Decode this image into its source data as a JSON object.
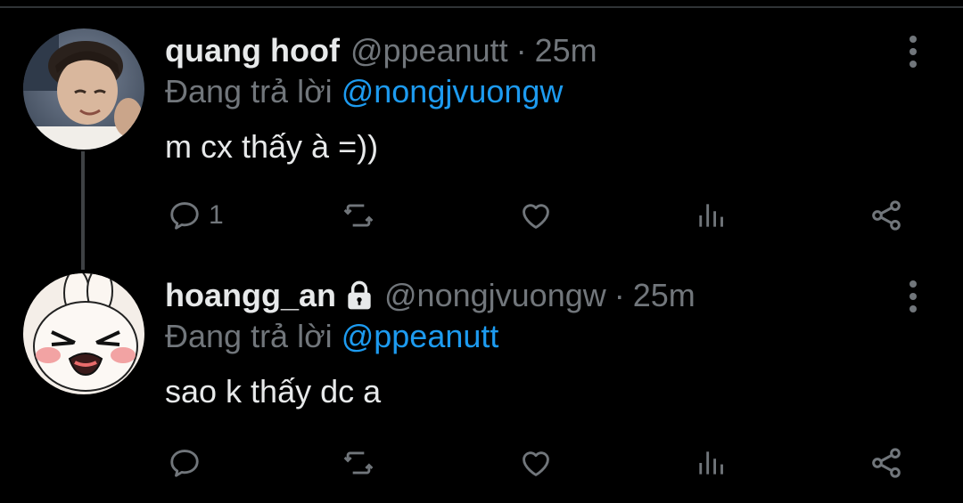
{
  "colors": {
    "background": "#000000",
    "text_primary": "#e7e9ea",
    "text_secondary": "#71767b",
    "accent": "#1d9bf0",
    "thread_line": "#3e4144"
  },
  "tweets": [
    {
      "display_name": "quang hoof",
      "protected": false,
      "handle": "@ppeanutt",
      "separator": "·",
      "time": "25m",
      "replying_prefix": "Đang trả lời",
      "replying_to": "@nongjvuongw",
      "text": "m cx thấy à =))",
      "avatar_icon": "user-photo-avatar",
      "actions": {
        "reply_count": "1",
        "retweet_count": "",
        "like_count": "",
        "views_count": ""
      }
    },
    {
      "display_name": "hoangg_an",
      "protected": true,
      "lock_icon": "lock-icon",
      "handle": "@nongjvuongw",
      "separator": "·",
      "time": "25m",
      "replying_prefix": "Đang trả lời",
      "replying_to": "@ppeanutt",
      "text": "sao k thấy dc a",
      "avatar_icon": "cartoon-bunny-avatar",
      "actions": {
        "reply_count": "",
        "retweet_count": "",
        "like_count": "",
        "views_count": ""
      }
    }
  ],
  "action_icons": [
    "reply-icon",
    "retweet-icon",
    "like-icon",
    "views-icon",
    "share-icon"
  ]
}
